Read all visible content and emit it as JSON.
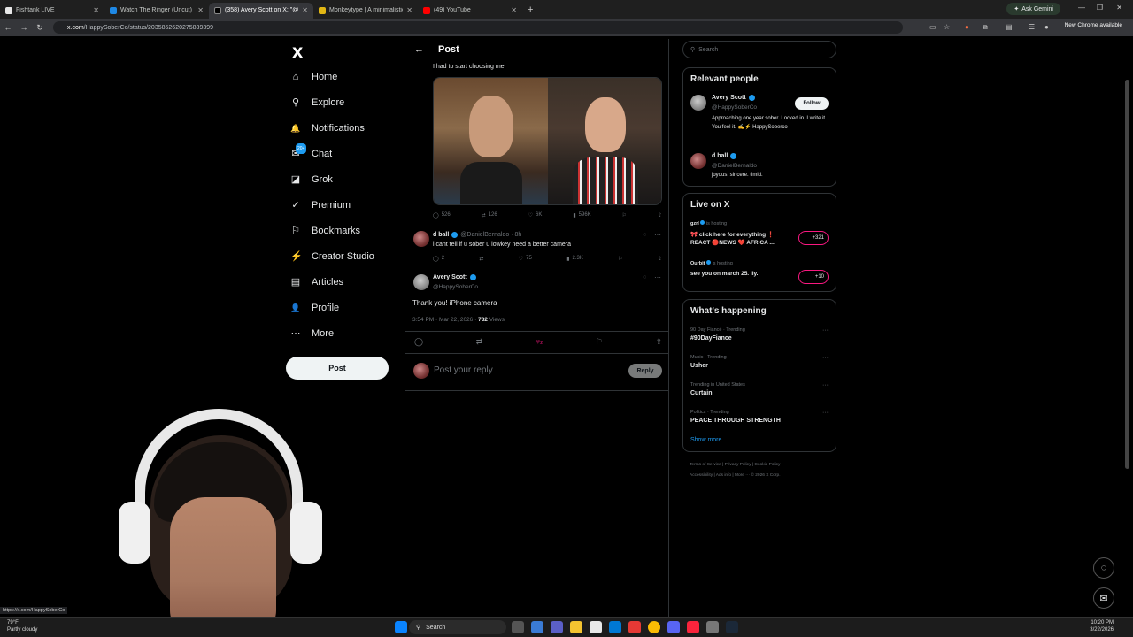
{
  "browser": {
    "tabs": [
      {
        "title": "Fishtank LIVE",
        "color": "#e8e8e8"
      },
      {
        "title": "Watch The Ringer (Uncut) | Pri",
        "color": "#1e88e5"
      },
      {
        "title": "(358) Avery Scott on X: \"@Dan",
        "color": "#fff"
      },
      {
        "title": "Monkeytype | A minimalistic, c",
        "color": "#e2b714"
      },
      {
        "title": "(49) YouTube",
        "color": "#ff0000"
      }
    ],
    "ask_gemini": "Ask Gemini",
    "url_domain": "x.com",
    "url_path": "/HappySoberCo/status/2035852620275839399",
    "new_chrome": "New Chrome available"
  },
  "nav": {
    "logo": "X",
    "items": [
      {
        "label": "Home",
        "icon": "⌂"
      },
      {
        "label": "Explore",
        "icon": "⚲"
      },
      {
        "label": "Notifications",
        "icon": "🔔"
      },
      {
        "label": "Chat",
        "icon": "✉"
      },
      {
        "label": "Grok",
        "icon": "◪"
      },
      {
        "label": "Premium",
        "icon": "✓"
      },
      {
        "label": "Bookmarks",
        "icon": "⚐"
      },
      {
        "label": "Creator Studio",
        "icon": "⚡"
      },
      {
        "label": "Articles",
        "icon": "▤"
      },
      {
        "label": "Profile",
        "icon": "👤"
      },
      {
        "label": "More",
        "icon": "⋯"
      }
    ],
    "chat_badge": "20+",
    "post_button": "Post"
  },
  "post": {
    "header": "Post",
    "quoted_text": "I had to start choosing me.",
    "quoted_stats": {
      "replies": "526",
      "reposts": "126",
      "likes": "6K",
      "views": "596K"
    },
    "reply": {
      "name": "d ball",
      "handle": "@DanielBernaldo · 8h",
      "text": "i cant tell if u sober u lowkey need a better camera",
      "replies": "2",
      "likes": "75",
      "views": "2.3K"
    },
    "main": {
      "name": "Avery Scott",
      "handle": "@HappySoberCo",
      "text": "Thank you! iPhone camera",
      "meta": "3:54 PM · Mar 22, 2026 ·",
      "views_count": "732",
      "views_label": "Views",
      "likes": "2"
    },
    "reply_placeholder": "Post your reply",
    "reply_button": "Reply"
  },
  "sidebar": {
    "search_placeholder": "Search",
    "relevant_title": "Relevant people",
    "people": [
      {
        "name": "Avery Scott",
        "handle": "@HappySoberCo",
        "bio": "Approaching one year sober. Locked in. I write it. You feel it. ✍️⚡ HappySoberco",
        "follow": "Follow"
      },
      {
        "name": "d ball",
        "handle": "@DanielBernaldo",
        "bio": "joyous. sincere. timid."
      }
    ],
    "live_title": "Live on X",
    "live": [
      {
        "host": "gzrl",
        "status": "is hosting",
        "title": "🎀 click here for everything ❗ REACT 🔴NEWS ❤️ AFRICA ...",
        "count": "+321"
      },
      {
        "host": "Ourbit",
        "status": "is hosting",
        "title": "see you on march 25. lly.",
        "count": "+10"
      }
    ],
    "happening_title": "What's happening",
    "trends": [
      {
        "context": "90 Day Fiancé · Trending",
        "name": "#90DayFiance"
      },
      {
        "context": "Music · Trending",
        "name": "Usher"
      },
      {
        "context": "Trending in United States",
        "name": "Curtain"
      },
      {
        "context": "Politics · Trending",
        "name": "PEACE THROUGH STRENGTH"
      }
    ],
    "show_more": "Show more",
    "footer1": "Terms of Service  |  Privacy Policy  |  Cookie Policy  |",
    "footer2": "Accessibility  |  Ads info  |  More ···  © 2026 X Corp."
  },
  "taskbar": {
    "weather_temp": "79°F",
    "weather_desc": "Partly cloudy",
    "search": "Search",
    "time": "10:20 PM",
    "date": "3/22/2026",
    "status_url": "https://x.com/HappySoberCo"
  }
}
